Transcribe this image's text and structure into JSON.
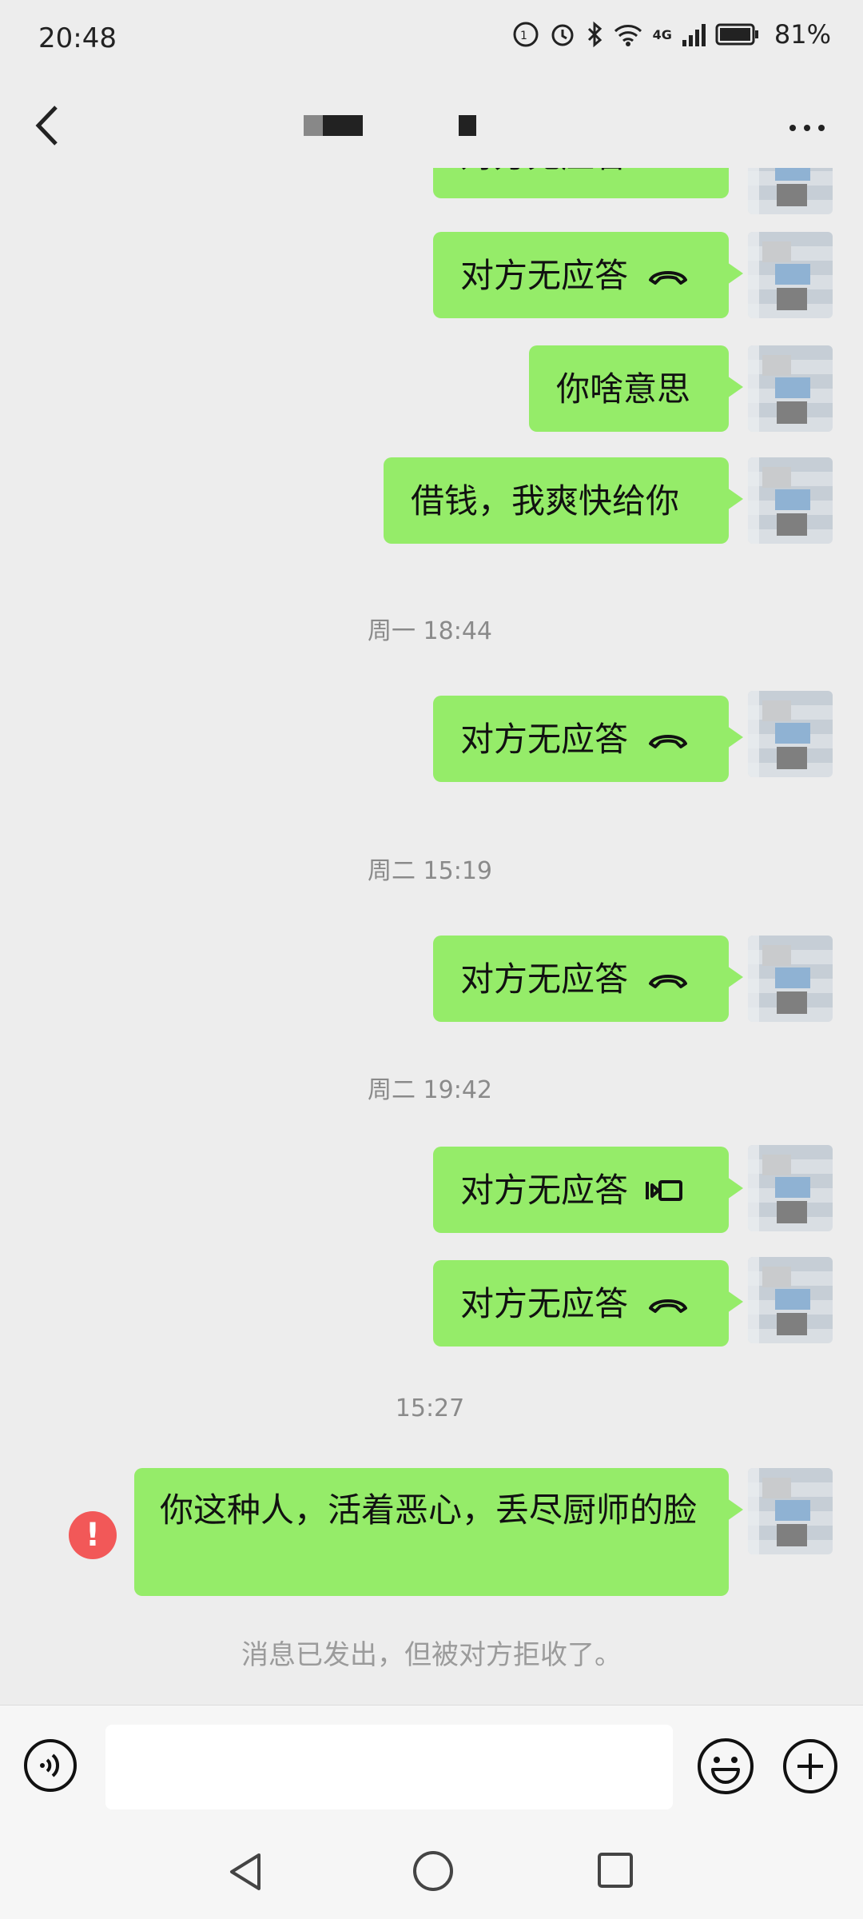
{
  "status_bar": {
    "time": "20:48",
    "network_label": "4G",
    "battery": "81%"
  },
  "header": {
    "back_label": "",
    "title": "",
    "more_label": "···"
  },
  "messages": [
    {
      "type": "call",
      "text": "对方无应答",
      "icon": "phone-hangup-icon"
    },
    {
      "type": "call",
      "text": "对方无应答",
      "icon": "phone-hangup-icon"
    },
    {
      "type": "text",
      "text": "你啥意思"
    },
    {
      "type": "text",
      "text": "借钱，我爽快给你"
    },
    {
      "type": "timestamp",
      "text": "周一 18:44"
    },
    {
      "type": "call",
      "text": "对方无应答",
      "icon": "phone-hangup-icon"
    },
    {
      "type": "timestamp",
      "text": "周二 15:19"
    },
    {
      "type": "call",
      "text": "对方无应答",
      "icon": "phone-hangup-icon"
    },
    {
      "type": "timestamp",
      "text": "周二 19:42"
    },
    {
      "type": "call",
      "text": "对方无应答",
      "icon": "video-call-icon"
    },
    {
      "type": "call",
      "text": "对方无应答",
      "icon": "phone-hangup-icon"
    },
    {
      "type": "timestamp",
      "text": "15:27"
    },
    {
      "type": "text",
      "text": "你这种人，活着恶心，丢尽厨师的脸",
      "status": "failed"
    },
    {
      "type": "system",
      "text": "消息已发出，但被对方拒收了。"
    }
  ],
  "input": {
    "placeholder": "",
    "value": ""
  },
  "colors": {
    "bubble": "#95ec69",
    "background": "#ededed",
    "error": "#f25858"
  }
}
